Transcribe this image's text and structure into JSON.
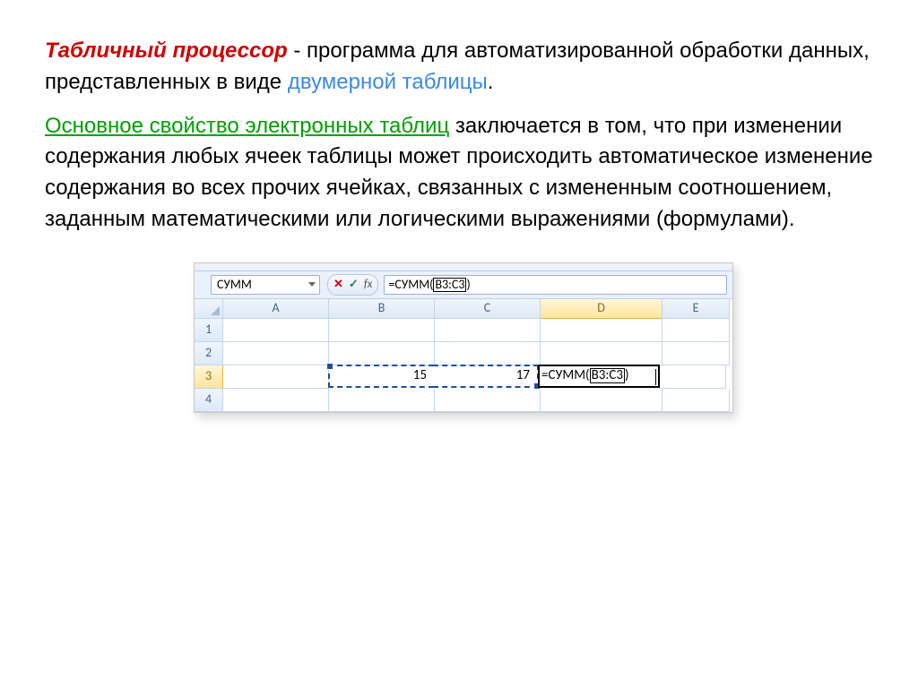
{
  "paragraph1": {
    "term": "Табличный процессор",
    "mid": " - программа для автоматизированной обработки данных, представленных в виде ",
    "blue": "двумерной таблицы",
    "end": "."
  },
  "paragraph2": {
    "green": "Основное свойство электронных таблиц",
    "rest": " заключается в том, что при изменении содержания любых ячеек таблицы может происходить автоматическое изменение содержания во всех прочих ячейках, связанных с измененным соотношением, заданным математическими или логическими выражениями (формулами)."
  },
  "excel": {
    "name_box": "СУММ",
    "cancel_icon": "✕",
    "enter_icon": "✓",
    "fx_label": "fx",
    "formula_prefix": "=СУММ(",
    "formula_range": "B3:C3",
    "formula_suffix": ")",
    "columns": [
      "A",
      "B",
      "C",
      "D",
      "E"
    ],
    "rows": [
      "1",
      "2",
      "3",
      "4"
    ],
    "values": {
      "B3": "15",
      "C3": "17"
    },
    "editing": {
      "prefix": "=СУММ(",
      "range": "B3:C3",
      "suffix": ")"
    }
  }
}
